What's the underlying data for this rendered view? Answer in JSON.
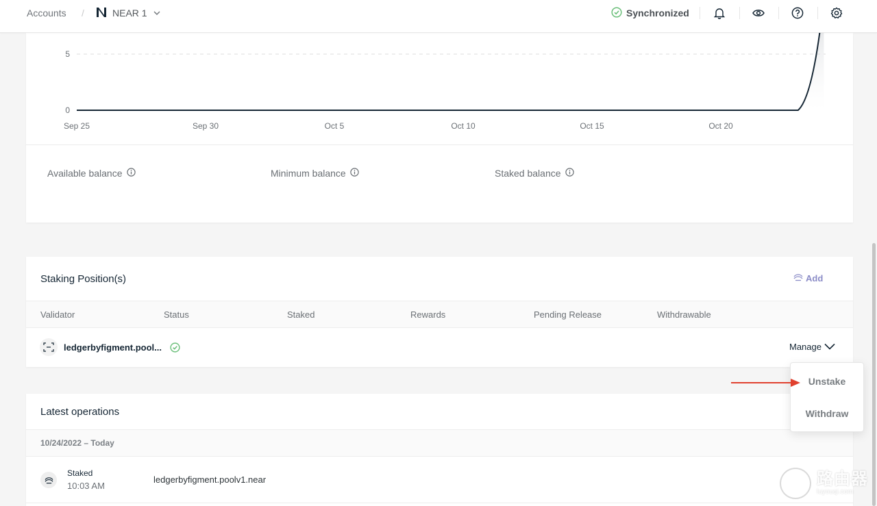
{
  "topbar": {
    "breadcrumb_root": "Accounts",
    "breadcrumb_sep": "/",
    "account_name": "NEAR 1",
    "sync_status": "Synchronized",
    "icons": [
      "bell-icon",
      "eye-icon",
      "help-icon",
      "settings-icon"
    ]
  },
  "colors": {
    "sync_green": "#6bbf7a",
    "add_accent": "#8b8cc7",
    "arrow_red": "#e0402e",
    "chart_line": "#142533"
  },
  "chart_data": {
    "type": "area",
    "x_ticks": [
      "Sep 25",
      "Sep 30",
      "Oct 5",
      "Oct 10",
      "Oct 15",
      "Oct 20"
    ],
    "y_ticks": [
      0,
      5
    ],
    "x": [
      "Sep 25",
      "Sep 30",
      "Oct 5",
      "Oct 10",
      "Oct 15",
      "Oct 20",
      "Oct 23",
      "Oct 24"
    ],
    "series": [
      {
        "values": [
          0,
          0,
          0,
          0,
          0,
          0,
          0,
          10
        ]
      }
    ],
    "grid": true
  },
  "balances": {
    "available": "Available balance",
    "minimum": "Minimum balance",
    "staked": "Staked balance"
  },
  "staking": {
    "title": "Staking Position(s)",
    "add_label": "Add",
    "columns": [
      "Validator",
      "Status",
      "Staked",
      "Rewards",
      "Pending Release",
      "Withdrawable"
    ],
    "rows": [
      {
        "validator": "ledgerbyfigment.pool...",
        "status": "check-circle-icon",
        "manage_label": "Manage"
      }
    ]
  },
  "dropdown": {
    "items": [
      "Unstake",
      "Withdraw"
    ]
  },
  "operations": {
    "title": "Latest operations",
    "date_group": "10/24/2022 – Today",
    "items": [
      {
        "type": "Staked",
        "time": "10:03 AM",
        "account": "ledgerbyfigment.poolv1.near"
      }
    ]
  },
  "watermark": {
    "main": "路由器",
    "sub": "luyouqi.com"
  }
}
